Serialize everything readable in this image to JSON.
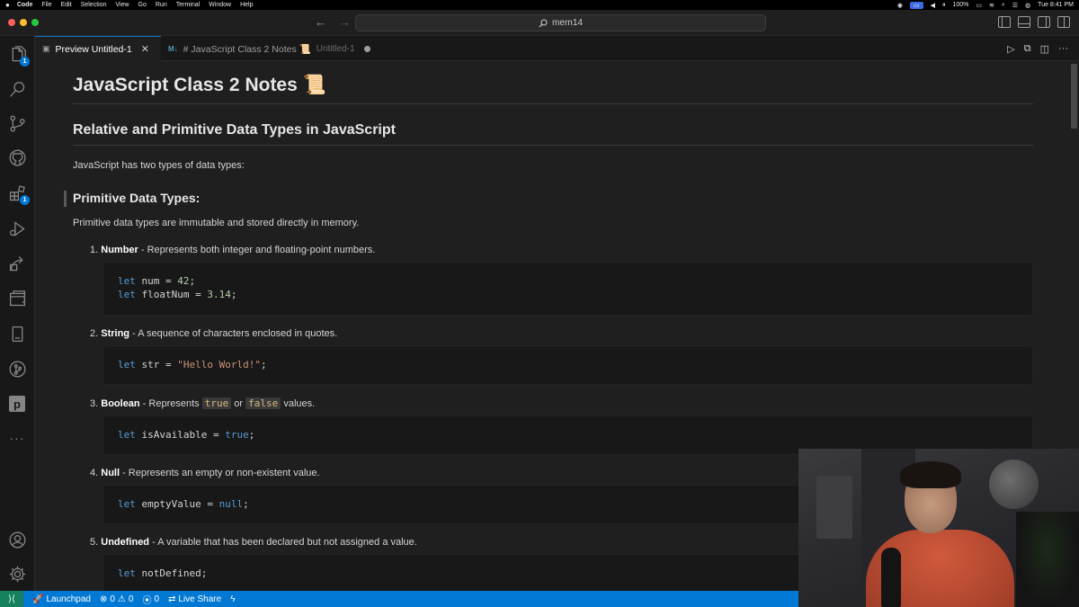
{
  "menubar": {
    "app": "Code",
    "items": [
      "File",
      "Edit",
      "Selection",
      "View",
      "Go",
      "Run",
      "Terminal",
      "Window",
      "Help"
    ],
    "battery": "100%",
    "clock": "Tue 8:41 PM"
  },
  "titlebar": {
    "search": "mern14",
    "nav_back": "←",
    "nav_forward": "→"
  },
  "activitybar": {
    "explorer_badge": "1",
    "extensions_badge": "1",
    "p_label": "p",
    "more": "···"
  },
  "tabs": {
    "active_label": "Preview Untitled-1",
    "inactive_label": "# JavaScript Class 2 Notes 📜",
    "inactive_sub": "Untitled-1",
    "md_icon": "M↓",
    "close": "✕"
  },
  "editor_actions": {
    "run": "▷",
    "open_source": "⧉",
    "split": "◫",
    "more": "···"
  },
  "content": {
    "h1": "JavaScript Class 2 Notes 📜",
    "h2": "Relative and Primitive Data Types in JavaScript",
    "intro": "JavaScript has two types of data types:",
    "h3": "Primitive Data Types:",
    "h3_desc": "Primitive data types are immutable and stored directly in memory.",
    "items": [
      {
        "n": "1.",
        "name": "Number",
        "desc": " - Represents both integer and floating-point numbers."
      },
      {
        "n": "2.",
        "name": "String",
        "desc": " - A sequence of characters enclosed in quotes."
      },
      {
        "n": "3.",
        "name": "Boolean",
        "desc_a": " - Represents ",
        "code_true": "true",
        "desc_or": " or ",
        "code_false": "false",
        "desc_b": " values."
      },
      {
        "n": "4.",
        "name": "Null",
        "desc": " - Represents an empty or non-existent value."
      },
      {
        "n": "5.",
        "name": "Undefined",
        "desc": " - A variable that has been declared but not assigned a value."
      }
    ],
    "code": {
      "let": "let",
      "num_var": " num = ",
      "num_val": "42",
      "float_var": " floatNum = ",
      "float_val": "3.14",
      "str_var": " str = ",
      "str_val": "\"Hello World!\"",
      "bool_var": " isAvailable = ",
      "bool_val": "true",
      "null_var": " emptyValue = ",
      "null_val": "null",
      "undef_var": " notDefined;",
      "semi": ";"
    }
  },
  "statusbar": {
    "launchpad": "Launchpad",
    "errors": "0",
    "warnings": "0",
    "ports": "0",
    "liveshare": "Live Share"
  },
  "colors": {
    "accent": "#0078d4",
    "statusbar": "#0078d4",
    "keyword": "#569cd6",
    "number": "#b5cea8",
    "string": "#ce9178"
  }
}
